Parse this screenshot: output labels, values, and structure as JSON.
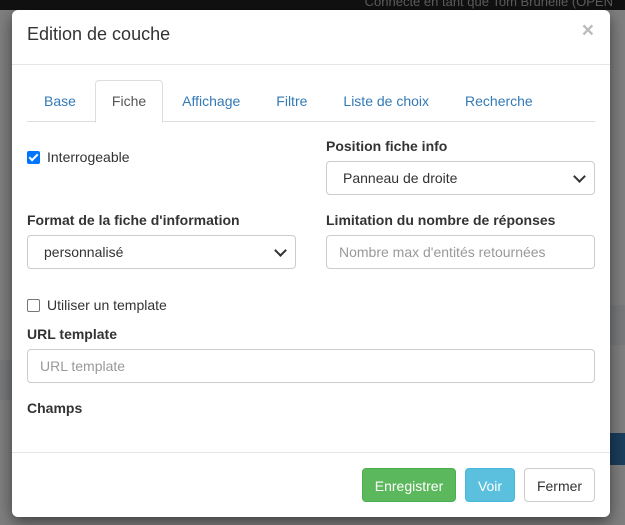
{
  "background": {
    "topbar_text": "Connecté en tant que Tom Brunelle (OPEN"
  },
  "modal": {
    "title": "Edition de couche",
    "close_symbol": "×"
  },
  "tabs": [
    {
      "label": "Base",
      "active": false
    },
    {
      "label": "Fiche",
      "active": true
    },
    {
      "label": "Affichage",
      "active": false
    },
    {
      "label": "Filtre",
      "active": false
    },
    {
      "label": "Liste de choix",
      "active": false
    },
    {
      "label": "Recherche",
      "active": false
    }
  ],
  "form": {
    "queryable": {
      "label": "Interrogeable",
      "checked": true
    },
    "info_position": {
      "label": "Position fiche info",
      "value": "Panneau de droite"
    },
    "info_format": {
      "label": "Format de la fiche d'information",
      "value": "personnalisé"
    },
    "max_results": {
      "label": "Limitation du nombre de réponses",
      "placeholder": "Nombre max d'entités retournées",
      "value": ""
    },
    "use_template": {
      "label": "Utiliser un template",
      "checked": false
    },
    "url_template": {
      "label": "URL template",
      "placeholder": "URL template",
      "value": ""
    },
    "fields": {
      "label": "Champs"
    }
  },
  "footer": {
    "save_label": "Enregistrer",
    "view_label": "Voir",
    "close_label": "Fermer"
  },
  "colors": {
    "save": "#5cb85c",
    "view": "#5bc0de",
    "link": "#337ab7",
    "checkbox": "#0075ff"
  }
}
